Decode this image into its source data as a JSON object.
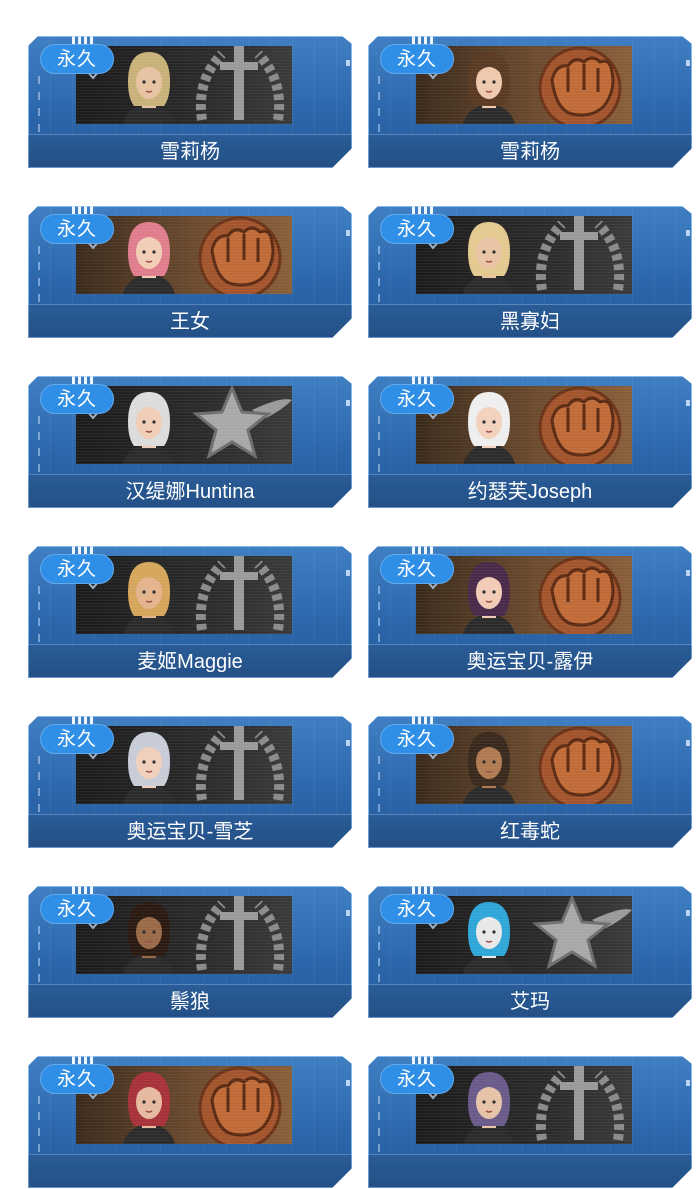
{
  "cards": [
    {
      "name": "雪莉杨",
      "badge": "永久",
      "emblem": "sword-wreath-icon",
      "theme": "grey",
      "hair": "#c9b27a",
      "skin": "#e6c3a3"
    },
    {
      "name": "雪莉杨",
      "badge": "永久",
      "emblem": "fist-icon",
      "theme": "orange",
      "hair": "#5b3a24",
      "skin": "#edc8ad"
    },
    {
      "name": "王女",
      "badge": "永久",
      "emblem": "fist-icon",
      "theme": "orange",
      "hair": "#e07d8c",
      "skin": "#f2cdb6"
    },
    {
      "name": "黑寡妇",
      "badge": "永久",
      "emblem": "sword-wreath-icon",
      "theme": "grey",
      "hair": "#e3c98f",
      "skin": "#e8c4a4"
    },
    {
      "name": "汉缇娜Huntina",
      "badge": "永久",
      "emblem": "star-wing-icon",
      "theme": "grey",
      "hair": "#dcdcdc",
      "skin": "#efcdb6"
    },
    {
      "name": "约瑟芙Joseph",
      "badge": "永久",
      "emblem": "fist-icon",
      "theme": "orange",
      "hair": "#eeeeee",
      "skin": "#f3d2bd"
    },
    {
      "name": "麦姬Maggie",
      "badge": "永久",
      "emblem": "sword-wreath-icon",
      "theme": "grey",
      "hair": "#d4a55a",
      "skin": "#e3b48c"
    },
    {
      "name": "奥运宝贝-露伊",
      "badge": "永久",
      "emblem": "fist-icon",
      "theme": "orange",
      "hair": "#4a2a4a",
      "skin": "#f1cbb5"
    },
    {
      "name": "奥运宝贝-雪芝",
      "badge": "永久",
      "emblem": "sword-wreath-icon",
      "theme": "grey",
      "hair": "#c7ccd6",
      "skin": "#f0d0bc"
    },
    {
      "name": "红毒蛇",
      "badge": "永久",
      "emblem": "fist-icon",
      "theme": "orange",
      "hair": "#3a2a1e",
      "skin": "#b07a52"
    },
    {
      "name": "鬃狼",
      "badge": "永久",
      "emblem": "sword-wreath-icon",
      "theme": "grey",
      "hair": "#2a1a12",
      "skin": "#9a6a48"
    },
    {
      "name": "艾玛",
      "badge": "永久",
      "emblem": "star-wing-icon",
      "theme": "grey",
      "hair": "#2fa6d8",
      "skin": "#e8e8e8"
    },
    {
      "name": "",
      "badge": "永久",
      "emblem": "fist-icon",
      "theme": "orange",
      "hair": "#a8323a",
      "skin": "#e6b9a0"
    },
    {
      "name": "",
      "badge": "永久",
      "emblem": "sword-wreath-icon",
      "theme": "grey",
      "hair": "#6a5a8a",
      "skin": "#e6c3a8"
    }
  ]
}
